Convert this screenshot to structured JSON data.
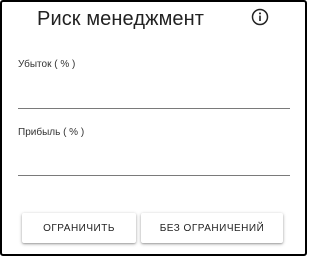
{
  "header": {
    "title": "Риск менеджмент",
    "info_icon": "info-circle-icon"
  },
  "form": {
    "loss": {
      "label": "Убыток ( % )",
      "value": "",
      "placeholder": ""
    },
    "profit": {
      "label": "Прибыль ( % )",
      "value": "",
      "placeholder": ""
    }
  },
  "actions": {
    "limit_label": "ОГРАНИЧИТЬ",
    "no_limit_label": "БЕЗ ОГРАНИЧЕНИЙ"
  }
}
